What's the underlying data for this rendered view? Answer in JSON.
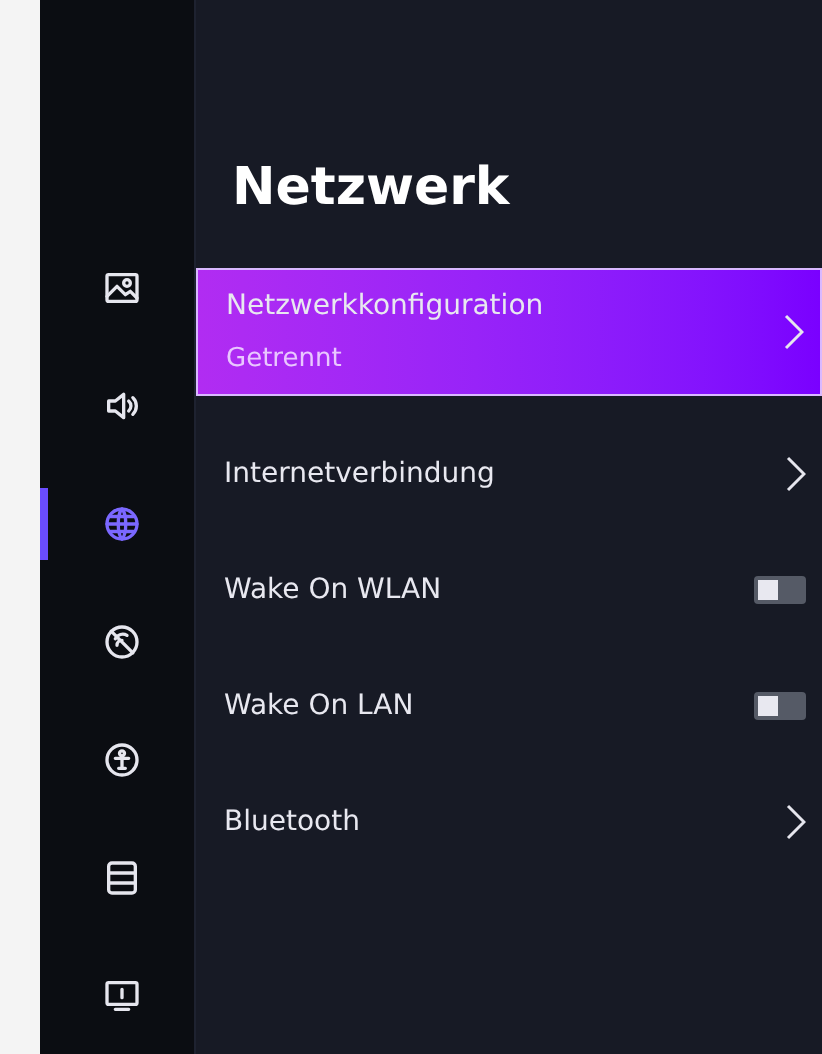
{
  "sidebar": {
    "items": [
      {
        "kind": "picture",
        "selected": false
      },
      {
        "kind": "sound",
        "selected": false
      },
      {
        "kind": "network",
        "selected": true
      },
      {
        "kind": "broadcast",
        "selected": false
      },
      {
        "kind": "accessibility",
        "selected": false
      },
      {
        "kind": "list",
        "selected": false
      },
      {
        "kind": "support",
        "selected": false
      }
    ]
  },
  "title": "Netzwerk",
  "items": [
    {
      "kind": "link",
      "label": "Netzwerkkonfiguration",
      "subtitle": "Getrennt",
      "selected": true
    },
    {
      "kind": "link",
      "label": "Internetverbindung",
      "selected": false
    },
    {
      "kind": "toggle",
      "label": "Wake On WLAN",
      "on": false,
      "selected": false
    },
    {
      "kind": "toggle",
      "label": "Wake On LAN",
      "on": false,
      "selected": false
    },
    {
      "kind": "link",
      "label": "Bluetooth",
      "selected": false
    }
  ]
}
